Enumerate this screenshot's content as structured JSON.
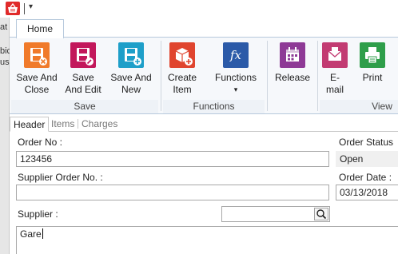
{
  "background_window": {
    "fragments": [
      "at",
      "bic",
      "us"
    ]
  },
  "ribbon": {
    "tabs": [
      {
        "label": "Home"
      }
    ],
    "buttons": {
      "save_and_close": {
        "line1": "Save And",
        "line2": "Close"
      },
      "save_and_edit": {
        "line1": "Save",
        "line2": "And Edit"
      },
      "save_and_new": {
        "line1": "Save And",
        "line2": "New"
      },
      "create_item": {
        "line1": "Create",
        "line2": "Item"
      },
      "functions": {
        "line1": "Functions",
        "line2": "▾"
      },
      "release": {
        "line1": "Release",
        "line2": ""
      },
      "email": {
        "line1": "E-",
        "line2": "mail"
      },
      "print": {
        "line1": "Print",
        "line2": ""
      }
    },
    "groups": {
      "save": "Save",
      "functions": "Functions",
      "view": "View"
    }
  },
  "form_tabs": [
    {
      "label": "Header"
    },
    {
      "label": "Items"
    },
    {
      "label": "Charges"
    }
  ],
  "form": {
    "order_no": {
      "label": "Order No :",
      "value": "123456"
    },
    "order_status": {
      "label": "Order Status :",
      "value": "Open"
    },
    "supplier_order_no": {
      "label": "Supplier Order No. :",
      "value": ""
    },
    "order_date": {
      "label": "Order Date :",
      "value": "03/13/2018"
    },
    "supplier": {
      "label": "Supplier :",
      "search_value": "",
      "text_value": "Gare"
    }
  },
  "colors": {
    "save_orange": "#f07a2a",
    "save_edit_magenta": "#c2185b",
    "save_new_teal": "#1e9fc9",
    "create_item_red": "#e0452f",
    "functions_blue": "#2b5aa8",
    "release_purple": "#8e3a96",
    "email_pink": "#c23b72",
    "print_green": "#2e9e4a"
  },
  "icons": {
    "app": "basket-icon",
    "save_and_close": "floppy-close-icon",
    "save_and_edit": "floppy-edit-icon",
    "save_and_new": "floppy-new-icon",
    "create_item": "box-plus-icon",
    "functions": "fx-icon",
    "release": "calendar-icon",
    "email": "envelope-icon",
    "print": "printer-icon",
    "search": "magnifier-icon"
  }
}
